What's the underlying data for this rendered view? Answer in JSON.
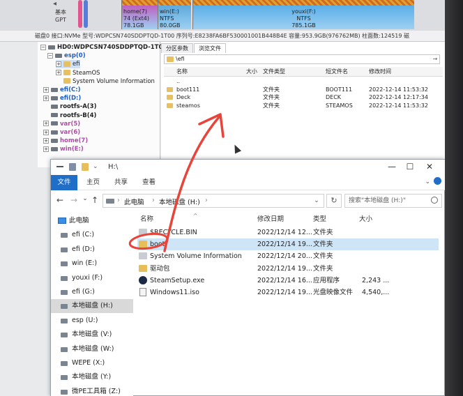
{
  "disk_strip": {
    "label_lines": [
      "基本",
      "GPT"
    ],
    "partitions": [
      {
        "color": "#e2558f",
        "lines": []
      },
      {
        "color": "#5b7bd8",
        "lines": []
      },
      {
        "color": "#c447b5",
        "lines": [
          "home(7)",
          "74 (Ext4)",
          "78.1GB"
        ]
      },
      {
        "color": "#4ea1d8",
        "lines": [
          "win(E:)",
          "NTFS",
          "80.0GB"
        ]
      },
      {
        "color": "#4aa6e6",
        "lines": [
          "youxi(F:)",
          "NTFS",
          "785.1GB"
        ]
      }
    ]
  },
  "disk_info": "磁盘0 接口:NVMe  型号:WDPCSN740SDDPTQD-1T00  序列号:E8238FA6BF530001001B448B4E  容量:953.9GB(976762MB)  柱面数:124519  磁",
  "tree": [
    {
      "exp": "−",
      "kind": "disk",
      "label": "HD0:WDPCSN740SDDPTQD-1T0",
      "indent": 4,
      "bold": true,
      "color": "#222"
    },
    {
      "exp": "−",
      "kind": "disk",
      "label": "esp(0)",
      "indent": 14,
      "bold": true,
      "color": "#1f5cc7"
    },
    {
      "exp": "+",
      "kind": "folder",
      "label": "efi",
      "indent": 26,
      "bold": false,
      "color": "#222",
      "sel": true
    },
    {
      "exp": "+",
      "kind": "folder",
      "label": "SteamOS",
      "indent": 26,
      "bold": false,
      "color": "#222"
    },
    {
      "exp": "",
      "kind": "folder",
      "label": "System Volume Information",
      "indent": 26,
      "bold": false,
      "color": "#222"
    },
    {
      "exp": "+",
      "kind": "disk",
      "label": "efi(C:)",
      "indent": 8,
      "bold": true,
      "color": "#1f5cc7"
    },
    {
      "exp": "+",
      "kind": "disk",
      "label": "efi(D:)",
      "indent": 8,
      "bold": true,
      "color": "#1f5cc7"
    },
    {
      "exp": "",
      "kind": "disk",
      "label": "rootfs-A(3)",
      "indent": 8,
      "bold": true,
      "color": "#222"
    },
    {
      "exp": "",
      "kind": "disk",
      "label": "rootfs-B(4)",
      "indent": 8,
      "bold": true,
      "color": "#222"
    },
    {
      "exp": "+",
      "kind": "disk",
      "label": "var(5)",
      "indent": 8,
      "bold": true,
      "color": "#b04aa8"
    },
    {
      "exp": "+",
      "kind": "disk",
      "label": "var(6)",
      "indent": 8,
      "bold": true,
      "color": "#b04aa8"
    },
    {
      "exp": "+",
      "kind": "disk",
      "label": "home(7)",
      "indent": 8,
      "bold": true,
      "color": "#b04aa8"
    },
    {
      "exp": "+",
      "kind": "disk",
      "label": "win(E:)",
      "indent": 8,
      "bold": true,
      "color": "#b04aa8"
    }
  ],
  "right_pane": {
    "tabs": [
      "分区参数",
      "浏览文件"
    ],
    "path": "\\efi",
    "go": "→",
    "columns": [
      "名称",
      "大小",
      "文件类型",
      "短文件名",
      "修改时间"
    ],
    "rows": [
      {
        "name": "..",
        "type": "",
        "short": "",
        "modified": "",
        "folder": false
      },
      {
        "name": "boot111",
        "type": "文件夹",
        "short": "BOOT111",
        "modified": "2022-12-14 11:53:32",
        "folder": true
      },
      {
        "name": "Deck",
        "type": "文件夹",
        "short": "DECK",
        "modified": "2022-12-14 12:17:34",
        "folder": true
      },
      {
        "name": "steamos",
        "type": "文件夹",
        "short": "STEAMOS",
        "modified": "2022-12-14 11:53:32",
        "folder": true
      }
    ]
  },
  "explorer": {
    "title": "H:\\",
    "window_buttons": {
      "minimize": "—",
      "maximize": "☐",
      "close": "✕"
    },
    "ribbon_tabs": [
      "文件",
      "主页",
      "共享",
      "查看"
    ],
    "nav": {
      "back": "←",
      "forward": "→",
      "dropdown": "⌄",
      "up": "↑",
      "refresh": "↻"
    },
    "breadcrumb": [
      "此电脑",
      "本地磁盘 (H:)"
    ],
    "crumb_sep": "›",
    "addr_dropdown": "⌄",
    "search_placeholder": "搜索\"本地磁盘 (H:)\"",
    "nav_items": [
      {
        "label": "此电脑",
        "kind": "pc",
        "sel": false
      },
      {
        "label": "efi (C:)",
        "kind": "drive",
        "sel": false
      },
      {
        "label": "efi (D:)",
        "kind": "drive",
        "sel": false
      },
      {
        "label": "win (E:)",
        "kind": "drive",
        "sel": false
      },
      {
        "label": "youxi (F:)",
        "kind": "drive",
        "sel": false
      },
      {
        "label": "efi (G:)",
        "kind": "drive",
        "sel": false
      },
      {
        "label": "本地磁盘 (H:)",
        "kind": "drive",
        "sel": true
      },
      {
        "label": "esp (U:)",
        "kind": "drive",
        "sel": false
      },
      {
        "label": "本地磁盘 (V:)",
        "kind": "drive",
        "sel": false
      },
      {
        "label": "本地磁盘 (W:)",
        "kind": "drive",
        "sel": false
      },
      {
        "label": "WEPE (X:)",
        "kind": "drive",
        "sel": false
      },
      {
        "label": "本地磁盘 (Y:)",
        "kind": "drive",
        "sel": false
      },
      {
        "label": "微PE工具箱 (Z:)",
        "kind": "drive",
        "sel": false
      }
    ],
    "columns": [
      "名称",
      "修改日期",
      "类型",
      "大小"
    ],
    "sort_arrow": "^",
    "files": [
      {
        "name": "$RECYCLE.BIN",
        "date": "2022/12/14 12...",
        "type": "文件夹",
        "size": "",
        "icon": "sys",
        "sel": false
      },
      {
        "name": "boot",
        "date": "2022/12/14 19...",
        "type": "文件夹",
        "size": "",
        "icon": "folder",
        "sel": true
      },
      {
        "name": "System Volume Information",
        "date": "2022/12/14 20...",
        "type": "文件夹",
        "size": "",
        "icon": "sys",
        "sel": false
      },
      {
        "name": "驱动包",
        "date": "2022/12/14 19...",
        "type": "文件夹",
        "size": "",
        "icon": "folder",
        "sel": false
      },
      {
        "name": "SteamSetup.exe",
        "date": "2022/12/14 16...",
        "type": "应用程序",
        "size": "2,243 ...",
        "icon": "exe",
        "sel": false
      },
      {
        "name": "Windows11.iso",
        "date": "2022/12/14 19...",
        "type": "光盘映像文件",
        "size": "4,540,...",
        "icon": "iso",
        "sel": false
      }
    ]
  },
  "colors": {
    "accent": "#1f6ec7",
    "annotation": "#e8443a"
  }
}
